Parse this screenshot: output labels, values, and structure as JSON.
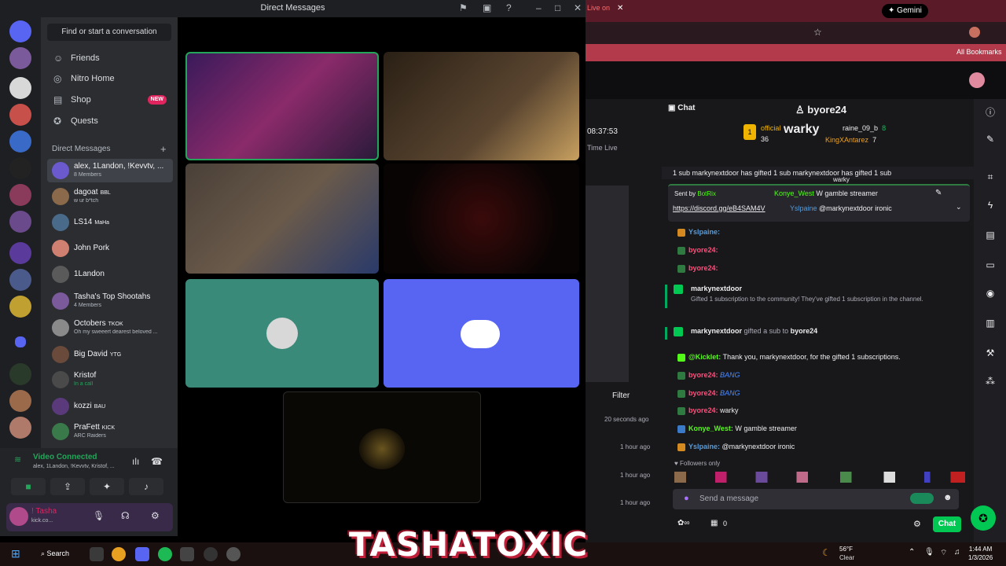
{
  "discord": {
    "window_title": "Direct Messages",
    "find_placeholder": "Find or start a conversation",
    "nav": [
      {
        "label": "Friends"
      },
      {
        "label": "Nitro Home"
      },
      {
        "label": "Shop",
        "badge": "NEW"
      },
      {
        "label": "Quests"
      }
    ],
    "dm_header": "Direct Messages",
    "dms": [
      {
        "name": "alex, 1Landon, !Kevvtv, ...",
        "sub": "8 Members",
        "color": "#6a5acd"
      },
      {
        "name": "dagoat",
        "tag": "BBL",
        "sub": "w ur b*tch",
        "color": "#8a6a4a"
      },
      {
        "name": "LS14",
        "tag": "MaHa",
        "sub": "",
        "color": "#4a6a8a"
      },
      {
        "name": "John Pork",
        "tag": "",
        "sub": "",
        "color": "#d08070"
      },
      {
        "name": "1Landon",
        "tag": "",
        "sub": "",
        "color": "#5a5a5a"
      },
      {
        "name": "Tasha's Top Shootahs",
        "sub": "4 Members",
        "color": "#7a5a9a"
      },
      {
        "name": "Octobers",
        "tag": "TKOK",
        "sub": "Oh my sweeert dearest beloved ...",
        "color": "#8a8a8a"
      },
      {
        "name": "Big David",
        "tag": "YTG",
        "sub": "",
        "color": "#6a4a3a"
      },
      {
        "name": "Kristof",
        "sub": "In a call",
        "color": "#4a4a4a"
      },
      {
        "name": "kozzi",
        "tag": "BAU",
        "sub": "",
        "color": "#5a3a7a"
      },
      {
        "name": "PraFett",
        "tag": "KICK",
        "sub": "ARC Raiders",
        "color": "#3a7a4a"
      }
    ],
    "voice": {
      "status": "Video Connected",
      "members": "alex, 1Landon, !Kevvtv, Kristof, ..."
    },
    "user": {
      "name": "! Tasha",
      "sub": "kick.co..."
    }
  },
  "browser": {
    "gemini_label": "Gemini",
    "live_label": "Live on",
    "bookmarks_label": "All Bookmarks"
  },
  "twitch": {
    "chat_label": "Chat",
    "channel_user": "byore24",
    "left_time": "08:37:53",
    "left_live": "Time Live",
    "filter_label": "Filter",
    "ago": [
      "20 seconds ago",
      "1 hour ago",
      "1 hour ago",
      "1 hour ago"
    ],
    "leaderboard": [
      {
        "name": "raine_09_b",
        "count": "8"
      },
      {
        "name": "KingXAntarez",
        "count": "7"
      }
    ],
    "hype_banner": "1 sub   markynextdoor has gifted 1 sub   markynextdoor has gifted 1 sub",
    "pinned": {
      "sent_by": "Sent by",
      "bot": "BotRix",
      "link": "https://discord.gg/eB4SAM4V",
      "warky": "warky",
      "m1_user": "Konye_West",
      "m1_text": "W gamble streamer",
      "m2_user": "Yslpaine",
      "m2_text": "@markynextdoor ironic"
    },
    "overlay_text": "warky",
    "top_user": "official",
    "top_count": "36",
    "messages_top": [
      {
        "user": "Yslpaine:",
        "text": "",
        "color": "#5b9bd5"
      },
      {
        "user": "byore24:",
        "text": "",
        "color": "#ff4f7b"
      },
      {
        "user": "byore24:",
        "text": "",
        "color": "#ff4f7b"
      }
    ],
    "gift1": {
      "user": "markynextdoor",
      "text": "Gifted 1 subscription to the community! They've gifted 1 subscription in the channel."
    },
    "gift2": {
      "user": "markynextdoor",
      "text": "gifted a sub to",
      "target": "byore24"
    },
    "messages": [
      {
        "user": "@Kicklet:",
        "text": "Thank you, markynextdoor, for the gifted 1 subscriptions.",
        "color": "#53fc18"
      },
      {
        "user": "byore24:",
        "text": "BANG",
        "color": "#ff4f7b"
      },
      {
        "user": "byore24:",
        "text": "BANG",
        "color": "#ff4f7b"
      },
      {
        "user": "byore24:",
        "text": "warky",
        "color": "#ff4f7b"
      },
      {
        "user": "Konye_West:",
        "text": "W gamble streamer",
        "color": "#53fc18"
      },
      {
        "user": "Yslpaine:",
        "text": "@markynextdoor ironic",
        "color": "#5b9bd5"
      }
    ],
    "followers_only": "Followers only",
    "send_placeholder": "Send a message",
    "points": "0",
    "chat_button": "Chat"
  },
  "brand": "TASHATOXIC",
  "taskbar": {
    "search": "Search",
    "weather_temp": "56°F",
    "weather_desc": "Clear",
    "time": "1:44 AM",
    "date": "1/3/2026"
  }
}
